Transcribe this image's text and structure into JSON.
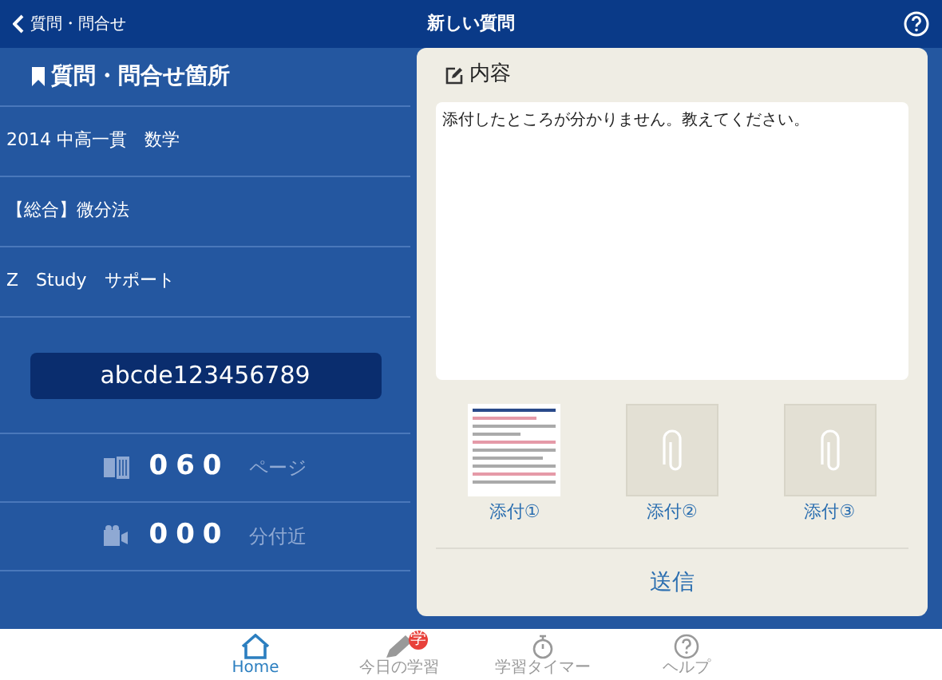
{
  "nav_bar": {
    "back": "質問・問合せ",
    "title": "新しい質問"
  },
  "sidebar": {
    "title": "質問・問合せ箇所",
    "rows": [
      "2014 中高一貫　数学",
      "【総合】微分法",
      "Z　Study　サポート"
    ],
    "code": "abcde123456789",
    "counters": [
      {
        "kind": "page",
        "value": "060",
        "unit": "ページ"
      },
      {
        "kind": "time",
        "value": "000",
        "unit": "分付近"
      }
    ]
  },
  "content_card": {
    "title": "内容",
    "message": "添付したところが分かりません。教えてください。",
    "attachments": [
      {
        "kind": "image",
        "label": "添付①"
      },
      {
        "kind": "empty",
        "label": "添付②"
      },
      {
        "kind": "empty",
        "label": "添付③"
      }
    ],
    "send": "送信"
  },
  "tab_bar": [
    {
      "kind": "home",
      "label": "Home",
      "selected": true
    },
    {
      "kind": "pencil",
      "label": "今日の学習",
      "selected": false,
      "badge": "学"
    },
    {
      "kind": "timer",
      "label": "学習タイマー",
      "selected": false
    },
    {
      "kind": "help",
      "label": "ヘルプ",
      "selected": false
    }
  ]
}
